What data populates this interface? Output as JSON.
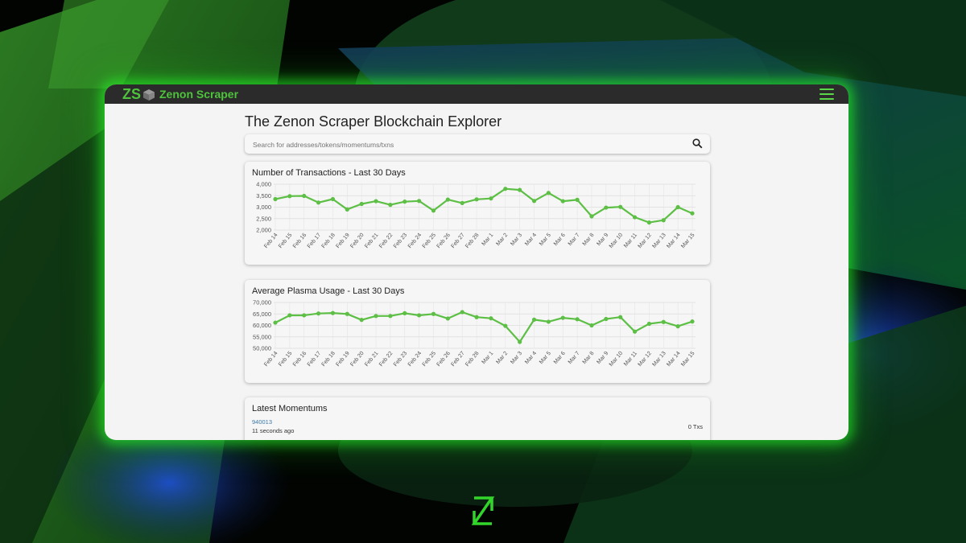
{
  "app": {
    "logo_text": "ZS",
    "title": "Zenon Scraper"
  },
  "page": {
    "title": "The Zenon Scraper Blockchain Explorer"
  },
  "search": {
    "placeholder": "Search for addresses/tokens/momentums/txns",
    "value": ""
  },
  "icons": {
    "menu": "hamburger-menu-icon",
    "search": "search-icon",
    "logo": "cube-icon",
    "brand": "zenon-z-logo"
  },
  "colors": {
    "accent": "#4ec33c",
    "line": "#5dbf45",
    "topbar": "#2b2b2b",
    "link": "#3a78a8"
  },
  "chart_data": [
    {
      "type": "line",
      "title": "Number of Transactions - Last 30 Days",
      "x": [
        "Feb 14",
        "Feb 15",
        "Feb 16",
        "Feb 17",
        "Feb 18",
        "Feb 19",
        "Feb 20",
        "Feb 21",
        "Feb 22",
        "Feb 23",
        "Feb 24",
        "Feb 25",
        "Feb 26",
        "Feb 27",
        "Feb 28",
        "Mar 1",
        "Mar 2",
        "Mar 3",
        "Mar 4",
        "Mar 5",
        "Mar 6",
        "Mar 7",
        "Mar 8",
        "Mar 9",
        "Mar 10",
        "Mar 11",
        "Mar 12",
        "Mar 13",
        "Mar 14",
        "Mar 15"
      ],
      "values": [
        3350,
        3480,
        3490,
        3200,
        3350,
        2900,
        3140,
        3260,
        3100,
        3240,
        3270,
        2850,
        3330,
        3180,
        3340,
        3380,
        3800,
        3750,
        3270,
        3620,
        3260,
        3320,
        2600,
        2980,
        3010,
        2560,
        2330,
        2430,
        3000,
        2730
      ],
      "ylim": [
        2000,
        4000
      ],
      "yticks": [
        "4,000",
        "3,500",
        "3,000",
        "2,500",
        "2,000"
      ],
      "grid": true
    },
    {
      "type": "line",
      "title": "Average Plasma Usage - Last 30 Days",
      "x": [
        "Feb 14",
        "Feb 15",
        "Feb 16",
        "Feb 17",
        "Feb 18",
        "Feb 19",
        "Feb 20",
        "Feb 21",
        "Feb 22",
        "Feb 23",
        "Feb 24",
        "Feb 25",
        "Feb 26",
        "Feb 27",
        "Feb 28",
        "Mar 1",
        "Mar 2",
        "Mar 3",
        "Mar 4",
        "Mar 5",
        "Mar 6",
        "Mar 7",
        "Mar 8",
        "Mar 9",
        "Mar 10",
        "Mar 11",
        "Mar 12",
        "Mar 13",
        "Mar 14",
        "Mar 15"
      ],
      "values": [
        61200,
        64400,
        64400,
        65200,
        65400,
        65000,
        62400,
        64100,
        64100,
        65300,
        64400,
        65000,
        63000,
        65800,
        63600,
        63100,
        59800,
        52800,
        62500,
        61600,
        63300,
        62700,
        60000,
        62800,
        63600,
        57300,
        60700,
        61500,
        59600,
        61700
      ],
      "ylim": [
        50000,
        70000
      ],
      "yticks": [
        "70,000",
        "65,000",
        "60,000",
        "55,000",
        "50,000"
      ],
      "grid": true
    }
  ],
  "momentums": {
    "title": "Latest Momentums",
    "items": [
      {
        "height": "940013",
        "age": "11 seconds ago",
        "txs": "0 Txs"
      }
    ]
  }
}
